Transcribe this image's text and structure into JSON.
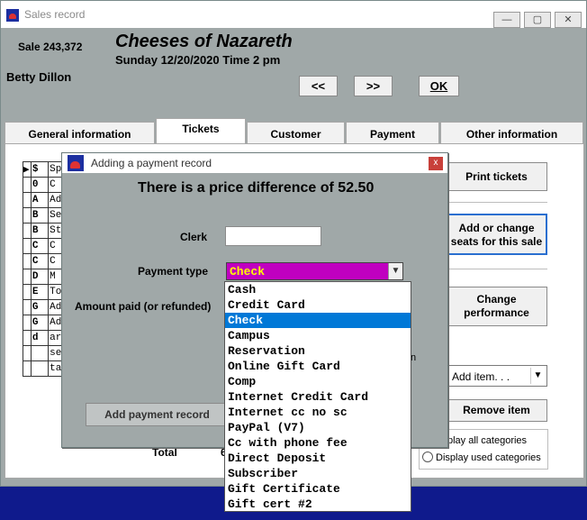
{
  "window": {
    "title": "Sales record",
    "controls": {
      "minimize": "—",
      "maximize": "▢",
      "close": "✕"
    }
  },
  "sale": {
    "number": "Sale 243,372",
    "customer": "Betty Dillon",
    "show_title": "Cheeses of Nazareth",
    "show_datetime": "Sunday 12/20/2020  Time 2 pm"
  },
  "nav": {
    "prev": "<<",
    "next": ">>",
    "ok": "OK"
  },
  "tabs": [
    {
      "label": "General information"
    },
    {
      "label": "Tickets",
      "active": true
    },
    {
      "label": "Customer"
    },
    {
      "label": "Payment"
    },
    {
      "label": "Other information"
    }
  ],
  "ticket_grid": [
    [
      "▶",
      "$",
      "Sp"
    ],
    [
      "",
      "0",
      "C"
    ],
    [
      "",
      "A",
      "Ad"
    ],
    [
      "",
      "B",
      "Se"
    ],
    [
      "",
      "B",
      "St"
    ],
    [
      "",
      "C",
      "C"
    ],
    [
      "",
      "C",
      "C"
    ],
    [
      "",
      "D",
      "M"
    ],
    [
      "",
      "E",
      "To"
    ],
    [
      "",
      "G",
      "Ad"
    ],
    [
      "",
      "G",
      "Ad"
    ],
    [
      "",
      "d",
      "ar"
    ],
    [
      "",
      "",
      "se"
    ],
    [
      "",
      "",
      "ta"
    ]
  ],
  "side": {
    "print_tickets": "Print tickets",
    "add_change_line1": "Add or change",
    "add_change_line2": "seats for this sale",
    "change_perf_line1": "Change",
    "change_perf_line2": "performance",
    "add_item": "Add item. . .",
    "remove_item": "Remove item",
    "display_all": "play all categories",
    "display_used": "Display used categories"
  },
  "total": {
    "label": "Total",
    "value": "6"
  },
  "dialog": {
    "title": "Adding a payment record",
    "close": "x",
    "heading": "There is a price difference of 52.50",
    "clerk_label": "Clerk",
    "clerk_value": "",
    "payment_type_label": "Payment type",
    "payment_type_value": "Check",
    "amount_label": "Amount paid (or refunded)",
    "partial_text": "n",
    "add_button": "Add payment record"
  },
  "payment_options": [
    "Cash",
    "Credit Card",
    "Check",
    "Campus",
    "Reservation",
    "Online Gift Card",
    "Comp",
    "Internet Credit Card",
    "Internet cc no sc",
    "PayPal (V7)",
    "Cc with phone fee",
    "Direct Deposit",
    "Subscriber",
    "Gift Certificate",
    "Gift cert #2"
  ],
  "selected_option_index": 2,
  "colors": {
    "window_bg": "#a0a8a8",
    "taskbar": "#0f1a8c",
    "selection": "#0078d7",
    "payment_field_bg": "#c000c0",
    "payment_field_text": "#ffff00"
  }
}
